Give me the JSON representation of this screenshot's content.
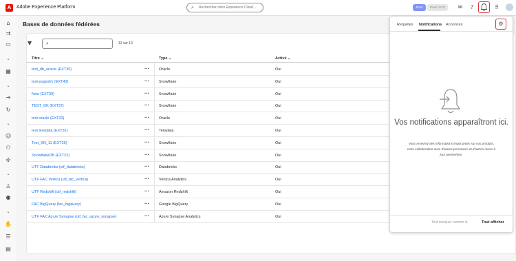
{
  "header": {
    "app_title": "Adobe Experience Platform",
    "search_placeholder": "Rechercher dans Experience Cloud...",
    "prod_badge": "Prod",
    "sandbox_name": "Prod (VA7)",
    "icons": [
      "help-icon",
      "bell-icon",
      "apps-grid-icon",
      "avatar"
    ]
  },
  "rail": {
    "icons": [
      "home-icon",
      "arrows-icon",
      "browse-icon",
      "chevron-icon",
      "dashboard-icon",
      "chevron-icon",
      "import-icon",
      "refresh-icon",
      "chevron-icon",
      "profile-icon",
      "segments-icon",
      "identity-icon",
      "chevron-icon",
      "person-icon",
      "group-icon",
      "chevron-icon",
      "hand-icon",
      "list-icon",
      "data-icon"
    ]
  },
  "main": {
    "page_title": "Bases de données fédérées",
    "result_count": "13 sur 13",
    "columns": {
      "title": "Titre",
      "type": "Type",
      "active": "Activé"
    },
    "rows": [
      {
        "title": "test_db_oracle (EXT35)",
        "type": "Oracle",
        "active": "Oui"
      },
      {
        "title": "test-yogesh1 (EXT43)",
        "type": "Snowflake",
        "active": "Oui"
      },
      {
        "title": "New (EXT39)",
        "type": "Snowflake",
        "active": "Oui"
      },
      {
        "title": "TEST_DK (EXT37)",
        "type": "Snowflake",
        "active": "Oui"
      },
      {
        "title": "test oracle (EXT32)",
        "type": "Oracle",
        "active": "Oui"
      },
      {
        "title": "test teradata (EXT31)",
        "type": "Teradata",
        "active": "Oui"
      },
      {
        "title": "Test_SN_11 (EXT29)",
        "type": "Snowflake",
        "active": "Oui"
      },
      {
        "title": "SnowflakeDB (EXT22)",
        "type": "Snowflake",
        "active": "Oui"
      },
      {
        "title": "UTF Databricks (utf_databricks)",
        "type": "Databricks",
        "active": "Oui"
      },
      {
        "title": "UTF FAC Vertica (utf_fac_vertica)",
        "type": "Vertica Analytics",
        "active": "Oui"
      },
      {
        "title": "UTF Redshift (utf_redshift)",
        "type": "Amazon Redshift",
        "active": "Oui"
      },
      {
        "title": "FAC BigQuery (fac_bigquery)",
        "type": "Google BigQuery",
        "active": "Oui"
      },
      {
        "title": "UTF FAC Azure Synapse (utf_fac_azure_synapse)",
        "type": "Azure Synapse Analytics",
        "active": "Oui"
      }
    ]
  },
  "notifications": {
    "tabs": [
      "Requêtes",
      "Notifications",
      "Annonces"
    ],
    "active_tab": "Notifications",
    "empty_title": "Vos notifications apparaîtront ici.",
    "empty_description": "Vous recevrez des informations importantes sur vos produits, votre collaboration avec d'autres personnes et d'autres mises à jour pertinentes.",
    "mark_all_label": "Tout marquer comme lu",
    "show_all_label": "Tout afficher"
  },
  "colors": {
    "link": "#1473e6",
    "highlight": "#d7373f",
    "brand": "#eb1000",
    "prod": "#8594f7"
  }
}
